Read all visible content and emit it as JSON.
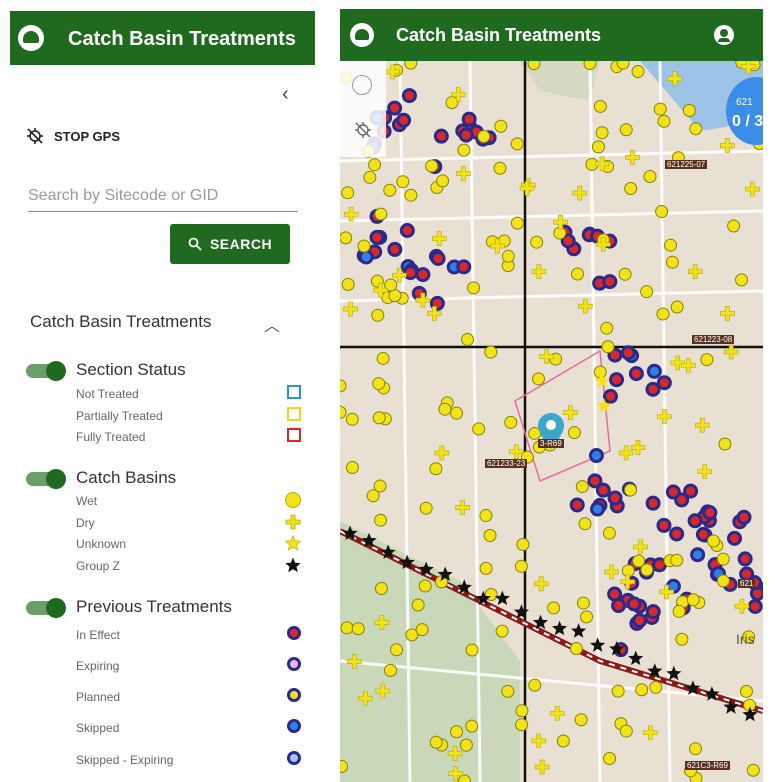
{
  "app": {
    "title": "Catch Basin Treatments"
  },
  "sidebar": {
    "collapse_icon": "‹",
    "gps_label": "STOP GPS",
    "search": {
      "placeholder": "Search by Sitecode or GID",
      "value": ""
    },
    "search_button": "SEARCH",
    "layer_group_title": "Catch Basin Treatments",
    "layers": [
      {
        "title": "Section Status",
        "enabled": true,
        "items": [
          {
            "label": "Not Treated",
            "symbol": "square",
            "color": "#2f8fd8"
          },
          {
            "label": "Partially Treated",
            "symbol": "square",
            "color": "#f2d21a"
          },
          {
            "label": "Fully Treated",
            "symbol": "square",
            "color": "#d8282a"
          }
        ]
      },
      {
        "title": "Catch Basins",
        "enabled": true,
        "items": [
          {
            "label": "Wet",
            "symbol": "circle",
            "color": "#f2e21a"
          },
          {
            "label": "Dry",
            "symbol": "cross",
            "color": "#f2e21a"
          },
          {
            "label": "Unknown",
            "symbol": "star",
            "color": "#f2e21a"
          },
          {
            "label": "Group Z",
            "symbol": "star",
            "color": "#111111"
          }
        ]
      },
      {
        "title": "Previous Treatments",
        "enabled": true,
        "items": [
          {
            "label": "In Effect",
            "symbol": "circle",
            "fill": "#d8282a",
            "stroke": "#2a2a8a"
          },
          {
            "label": "Expiring",
            "symbol": "circle",
            "fill": "#e8b8e8",
            "stroke": "#2a2a8a"
          },
          {
            "label": "Planned",
            "symbol": "circle",
            "fill": "#f2e21a",
            "stroke": "#2a2a8a"
          },
          {
            "label": "Skipped",
            "symbol": "circle",
            "fill": "#2f7fe8",
            "stroke": "#2a2a8a"
          },
          {
            "label": "Skipped - Expiring",
            "symbol": "circle",
            "fill": "#9ac8f0",
            "stroke": "#2a2a8a"
          }
        ]
      }
    ]
  },
  "map": {
    "header_title": "Catch Basin Treatments",
    "cluster_badge": {
      "label": "621",
      "count": "0 / 3"
    },
    "tags": [
      "621225-07",
      "621223-08",
      "621C3-R69",
      "621233-23",
      "621"
    ],
    "selected_marker_label": "3-R69",
    "place_label": "Iris",
    "colors": {
      "brand": "#1f6a1f",
      "accent": "#3a8ee8",
      "map_bg": "#e8e1d3"
    }
  }
}
